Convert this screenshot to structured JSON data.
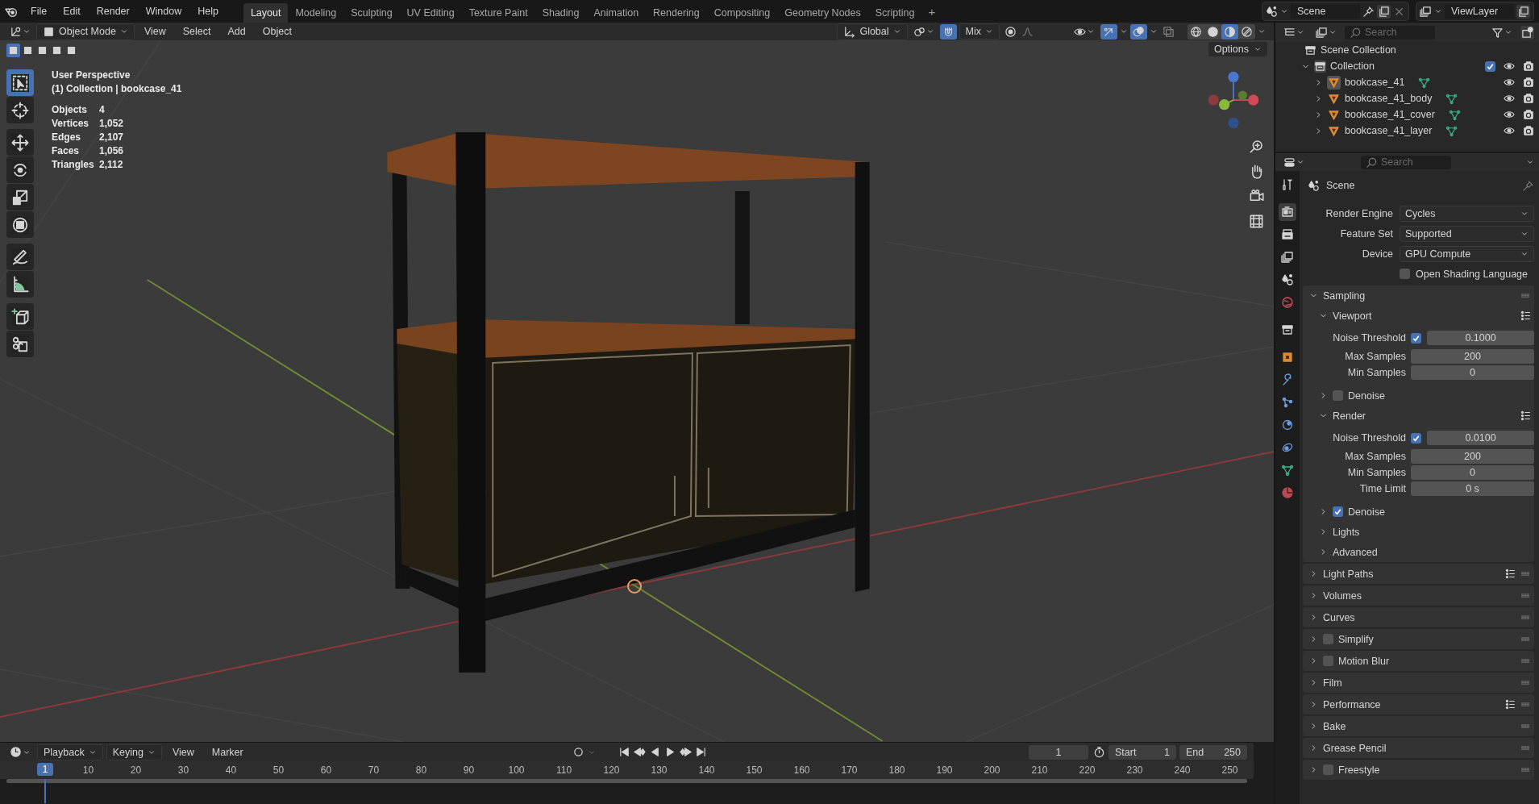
{
  "topbar": {
    "menus": [
      "File",
      "Edit",
      "Render",
      "Window",
      "Help"
    ],
    "workspaces": [
      {
        "label": "Layout",
        "selected": true
      },
      {
        "label": "Modeling",
        "selected": false
      },
      {
        "label": "Sculpting",
        "selected": false
      },
      {
        "label": "UV Editing",
        "selected": false
      },
      {
        "label": "Texture Paint",
        "selected": false
      },
      {
        "label": "Shading",
        "selected": false
      },
      {
        "label": "Animation",
        "selected": false
      },
      {
        "label": "Rendering",
        "selected": false
      },
      {
        "label": "Compositing",
        "selected": false
      },
      {
        "label": "Geometry Nodes",
        "selected": false
      },
      {
        "label": "Scripting",
        "selected": false
      }
    ],
    "add_workspace": "+",
    "scene": "Scene",
    "view_layer": "ViewLayer"
  },
  "viewport": {
    "mode": "Object Mode",
    "menus": [
      "View",
      "Select",
      "Add",
      "Object"
    ],
    "orientation": "Global",
    "snap_target": "Mix",
    "options": "Options",
    "select_modes": [
      {
        "selected": true
      },
      {
        "selected": false
      },
      {
        "selected": false
      },
      {
        "selected": false
      },
      {
        "selected": false
      }
    ],
    "gizmos_on": true,
    "overlays_on": true,
    "shading": [
      {
        "kind": "wireframe",
        "selected": false
      },
      {
        "kind": "solid",
        "selected": false
      },
      {
        "kind": "material",
        "selected": true
      },
      {
        "kind": "rendered",
        "selected": false
      }
    ],
    "view_name": "User Perspective",
    "context": "(1) Collection | bookcase_41",
    "stats": [
      {
        "label": "Objects",
        "value": "4"
      },
      {
        "label": "Vertices",
        "value": "1,052"
      },
      {
        "label": "Edges",
        "value": "2,107"
      },
      {
        "label": "Faces",
        "value": "1,056"
      },
      {
        "label": "Triangles",
        "value": "2,112"
      }
    ],
    "tools": [
      {
        "kind": "select",
        "selected": true
      },
      {
        "kind": "cursor",
        "selected": false
      },
      {
        "kind": "move",
        "selected": false
      },
      {
        "kind": "rotate",
        "selected": false
      },
      {
        "kind": "scale",
        "selected": false
      },
      {
        "kind": "transform",
        "selected": false
      },
      {
        "kind": "annotate",
        "selected": false
      },
      {
        "kind": "measure",
        "selected": false
      },
      {
        "kind": "add_cube",
        "selected": false
      },
      {
        "kind": "cut",
        "selected": false
      }
    ]
  },
  "timeline": {
    "menus": [
      {
        "label": "Playback",
        "dropdown": true
      },
      {
        "label": "Keying",
        "dropdown": true
      },
      {
        "label": "View",
        "dropdown": false
      },
      {
        "label": "Marker",
        "dropdown": false
      }
    ],
    "current_frame": "1",
    "start_label": "Start",
    "start": "1",
    "end_label": "End",
    "end": "250",
    "playhead": "1",
    "ticks": [
      "10",
      "20",
      "30",
      "40",
      "50",
      "60",
      "70",
      "80",
      "90",
      "100",
      "110",
      "120",
      "130",
      "140",
      "150",
      "160",
      "170",
      "180",
      "190",
      "200",
      "210",
      "220",
      "230",
      "240",
      "250"
    ]
  },
  "outliner": {
    "search_placeholder": "Search",
    "root": "Scene Collection",
    "collection": {
      "name": "Collection",
      "expanded": true,
      "checked": true
    },
    "objects": [
      {
        "name": "bookcase_41",
        "active": true
      },
      {
        "name": "bookcase_41_body",
        "active": false
      },
      {
        "name": "bookcase_41_cover",
        "active": false
      },
      {
        "name": "bookcase_41_layer",
        "active": false
      }
    ]
  },
  "properties": {
    "search_placeholder": "Search",
    "tabs": [
      {
        "kind": "tool",
        "selected": false
      },
      {
        "kind": "render",
        "selected": true
      },
      {
        "kind": "output",
        "selected": false
      },
      {
        "kind": "view_layer",
        "selected": false
      },
      {
        "kind": "scene",
        "selected": false
      },
      {
        "kind": "world",
        "selected": false
      },
      {
        "kind": "collection",
        "selected": false
      },
      {
        "kind": "object",
        "selected": false
      },
      {
        "kind": "modifiers",
        "selected": false
      },
      {
        "kind": "particles",
        "selected": false
      },
      {
        "kind": "physics",
        "selected": false
      },
      {
        "kind": "constraints",
        "selected": false
      },
      {
        "kind": "data",
        "selected": false
      },
      {
        "kind": "material",
        "selected": false
      }
    ],
    "context": "Scene",
    "fields": [
      {
        "label": "Render Engine",
        "value": "Cycles"
      },
      {
        "label": "Feature Set",
        "value": "Supported"
      },
      {
        "label": "Device",
        "value": "GPU Compute"
      }
    ],
    "osl": {
      "label": "Open Shading Language",
      "checked": false
    },
    "panels": [
      {
        "label": "Sampling",
        "expanded": true,
        "presets": false,
        "children": [
          {
            "label": "Viewport",
            "expanded": true,
            "presets": true,
            "rows": [
              {
                "kind": "check_number",
                "label": "Noise Threshold",
                "checked": true,
                "value": "0.1000"
              },
              {
                "kind": "number",
                "label": "Max Samples",
                "value": "200"
              },
              {
                "kind": "number",
                "label": "Min Samples",
                "value": "0"
              }
            ]
          },
          {
            "label": "Denoise",
            "expanded": false,
            "presets": false,
            "checked": false
          },
          {
            "label": "Render",
            "expanded": true,
            "presets": true,
            "rows": [
              {
                "kind": "check_number",
                "label": "Noise Threshold",
                "checked": true,
                "value": "0.0100"
              },
              {
                "kind": "number",
                "label": "Max Samples",
                "value": "200"
              },
              {
                "kind": "number",
                "label": "Min Samples",
                "value": "0"
              },
              {
                "kind": "number",
                "label": "Time Limit",
                "value": "0 s"
              }
            ]
          },
          {
            "label": "Denoise",
            "expanded": false,
            "presets": false,
            "checked": true
          },
          {
            "label": "Lights",
            "expanded": false,
            "presets": false
          },
          {
            "label": "Advanced",
            "expanded": false,
            "presets": false
          }
        ]
      },
      {
        "label": "Light Paths",
        "expanded": false,
        "presets": true
      },
      {
        "label": "Volumes",
        "expanded": false,
        "presets": false
      },
      {
        "label": "Curves",
        "expanded": false,
        "presets": false
      },
      {
        "label": "Simplify",
        "expanded": false,
        "presets": false,
        "checked": false
      },
      {
        "label": "Motion Blur",
        "expanded": false,
        "presets": false,
        "checked": false
      },
      {
        "label": "Film",
        "expanded": false,
        "presets": false
      },
      {
        "label": "Performance",
        "expanded": false,
        "presets": true
      },
      {
        "label": "Bake",
        "expanded": false,
        "presets": false
      },
      {
        "label": "Grease Pencil",
        "expanded": false,
        "presets": false
      },
      {
        "label": "Freestyle",
        "expanded": false,
        "presets": false,
        "checked": false
      }
    ]
  }
}
